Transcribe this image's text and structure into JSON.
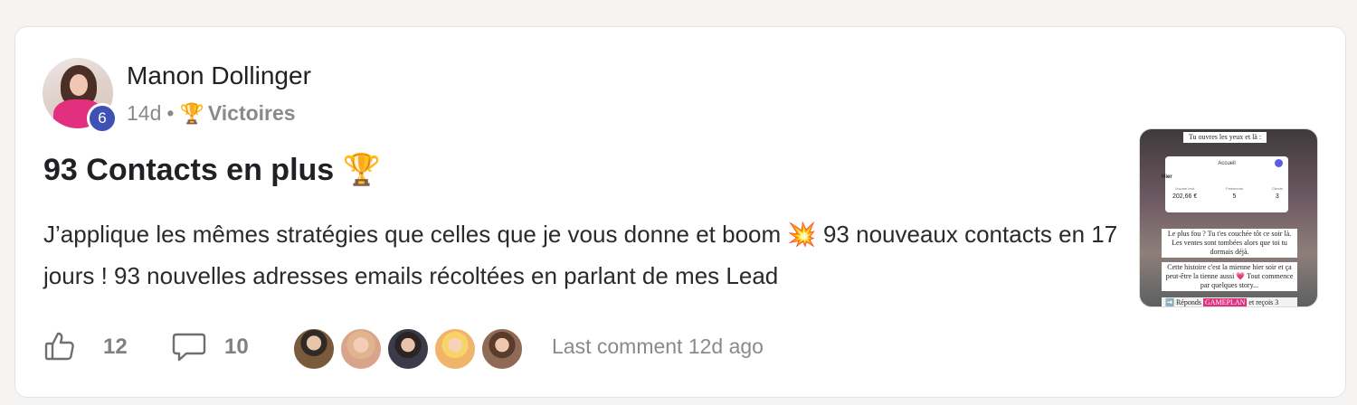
{
  "post": {
    "author": {
      "name": "Manon Dollinger",
      "level": "6"
    },
    "age": "14d",
    "separator": "•",
    "category": {
      "icon": "trophy-icon",
      "glyph": "🏆",
      "label": "Victoires"
    },
    "title": "93 Contacts en plus 🏆",
    "body": "J’applique les mêmes stratégies que celles que je vous donne et boom 💥 93 nouveaux contacts en 17 jours ! 93 nouvelles adresses emails récoltées en parlant de mes Lead",
    "thumbnail": {
      "caption_top": "Tu ouvres les yeux et là :",
      "panel_title": "Accueil",
      "panel_section": "Hier",
      "stats": [
        {
          "label": "Volume brut",
          "value": "202,66 €"
        },
        {
          "label": "Paiements",
          "value": "5"
        },
        {
          "label": "Clients",
          "value": "3"
        }
      ],
      "caption_middle": "Le plus fou ? Tu t'es couchée tôt ce soir là. Les ventes sont tombées alors que toi tu dormais déjà.",
      "caption_lower": "Cette histoire c'est la mienne hier soir et ça peut-être la tienne aussi 💗 Tout commence par quelques story...",
      "caption_bottom_prefix": "➡️ Réponds",
      "caption_bottom_highlight": "GAMEPLAN",
      "caption_bottom_suffix": "et reçois 3"
    },
    "likes": "12",
    "comments": "10",
    "last_comment": "Last comment 12d ago",
    "participant_colors": [
      "#7a5a3c",
      "#d9a58a",
      "#3b3b4a",
      "#f0b46a",
      "#8f6a55"
    ]
  },
  "colors": {
    "level_badge": "#3f51b5",
    "highlight": "#e0307f"
  }
}
